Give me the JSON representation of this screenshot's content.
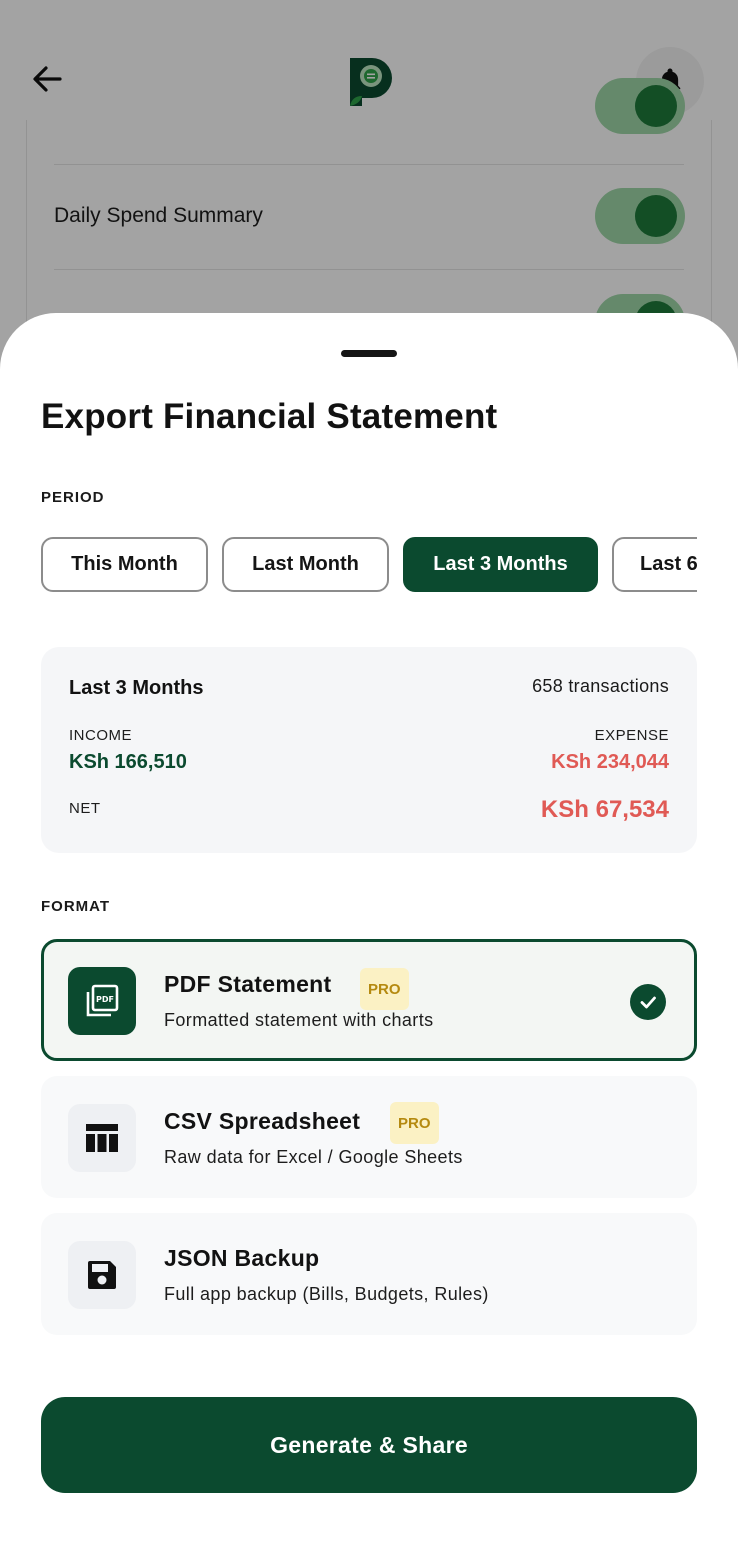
{
  "background": {
    "settings_row_label": "Daily Spend Summary"
  },
  "sheet": {
    "title": "Export Financial Statement",
    "period_label": "PERIOD",
    "period_options": [
      "This Month",
      "Last Month",
      "Last 3 Months",
      "Last 6"
    ],
    "selected_period": "Last 3 Months",
    "summary": {
      "period": "Last 3 Months",
      "transactions": "658 transactions",
      "income_label": "INCOME",
      "income_value": "KSh 166,510",
      "expense_label": "EXPENSE",
      "expense_value": "KSh 234,044",
      "net_label": "NET",
      "net_value": "KSh 67,534"
    },
    "format_label": "FORMAT",
    "formats": [
      {
        "title": "PDF Statement",
        "badge": "PRO",
        "subtitle": "Formatted statement with charts",
        "icon": "pdf-icon",
        "selected": true
      },
      {
        "title": "CSV Spreadsheet",
        "badge": "PRO",
        "subtitle": "Raw data for Excel / Google Sheets",
        "icon": "table-icon",
        "selected": false
      },
      {
        "title": "JSON Backup",
        "badge": "",
        "subtitle": "Full app backup (Bills, Budgets, Rules)",
        "icon": "save-icon",
        "selected": false
      }
    ],
    "cta_label": "Generate & Share"
  },
  "colors": {
    "brand": "#0b4a2f",
    "income": "#0b4a2f",
    "expense": "#e05a55",
    "pro_badge_bg": "#fbf1c4",
    "pro_badge_text": "#b58a10"
  }
}
